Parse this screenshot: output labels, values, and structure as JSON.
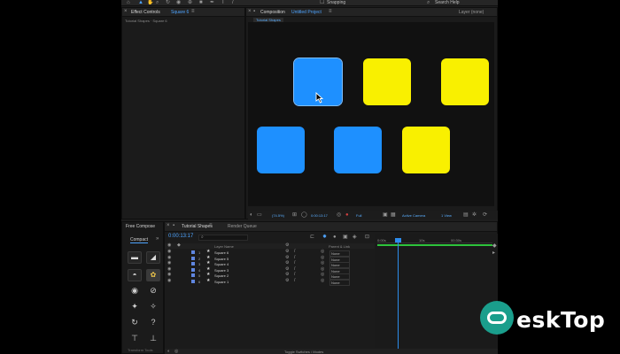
{
  "app": {
    "colors": {
      "accent": "#2d8ceb",
      "blue_shape": "#1e90ff",
      "yellow_shape": "#f9f000",
      "panel_bg": "#1b1b1b",
      "timeline_green": "#2ec43c",
      "layer_label": "#5f86e0"
    }
  },
  "toolbar": {
    "snapping_label": "Snapping",
    "search_help": "Search Help"
  },
  "effect_controls": {
    "tab_title": "Effect Controls",
    "tab_layer": "Square 6",
    "breadcrumb": "Tutorial Shapes · Square 6"
  },
  "composition": {
    "tab_title": "Composition",
    "tab_name": "Untitled Project",
    "layer_tab": "Layer (none)",
    "subtab": "Tutorial Shapes",
    "zoom": "(74.5%)",
    "timecode": "0:00:13:17",
    "resolution": "Full",
    "camera": "Active Camera",
    "view": "1 View",
    "shapes": [
      {
        "name": "square-top-left",
        "color": "blue"
      },
      {
        "name": "square-top-middle",
        "color": "yellow"
      },
      {
        "name": "square-top-right",
        "color": "yellow"
      },
      {
        "name": "square-bottom-left",
        "color": "blue"
      },
      {
        "name": "square-bottom-middle",
        "color": "blue"
      },
      {
        "name": "square-bottom-right",
        "color": "yellow"
      }
    ]
  },
  "tools_panel": {
    "title": "Free Compose",
    "tab": "Compact",
    "footer": "Transform Tools"
  },
  "timeline": {
    "tab_title": "Tutorial Shapes",
    "render_queue": "Render Queue",
    "timecode": "0:00:13:17",
    "search_placeholder": "",
    "col_layer_name": "Layer Name",
    "col_parent": "Parent & Link",
    "ruler": [
      "0:00s",
      "10s",
      "00:30s"
    ],
    "layers": [
      {
        "num": "1",
        "name": "Square 6",
        "parent": "None"
      },
      {
        "num": "2",
        "name": "Square 5",
        "parent": "None"
      },
      {
        "num": "3",
        "name": "Square 4",
        "parent": "None"
      },
      {
        "num": "4",
        "name": "Square 3",
        "parent": "None"
      },
      {
        "num": "5",
        "name": "Square 2",
        "parent": "None"
      },
      {
        "num": "6",
        "name": "Square 1",
        "parent": "None"
      }
    ],
    "footer": "Toggle Switches / Modes"
  },
  "watermark": {
    "text": "eskTop"
  }
}
